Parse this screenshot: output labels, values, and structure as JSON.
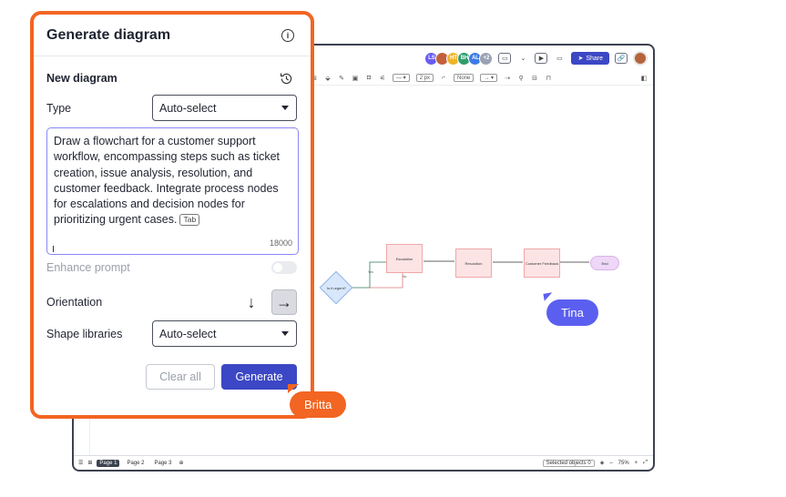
{
  "panel": {
    "title": "Generate diagram",
    "info_icon": "info-icon",
    "subtitle": "New diagram",
    "history_icon": "history-icon",
    "type_label": "Type",
    "type_value": "Auto-select",
    "prompt_text": "Draw a flowchart for a customer support workflow, encompassing steps such as ticket creation, issue analysis, resolution, and customer feedback. Integrate process nodes for escalations and decision nodes for prioritizing urgent cases.",
    "prompt_tab_chip": "Tab",
    "char_count": "18000",
    "enhance_label": "Enhance prompt",
    "enhance_enabled": false,
    "orientation_label": "Orientation",
    "orientation_options": [
      "↓",
      "→"
    ],
    "orientation_selected": "→",
    "shape_libraries_label": "Shape libraries",
    "shape_libraries_value": "Auto-select",
    "clear_label": "Clear all",
    "generate_label": "Generate"
  },
  "window": {
    "avatars": [
      {
        "initials": "LS",
        "color": "#6a5cf0"
      },
      {
        "initials": "",
        "color": "#c2603c"
      },
      {
        "initials": "HT",
        "color": "#f0b429"
      },
      {
        "initials": "BH",
        "color": "#2f9e6e"
      },
      {
        "initials": "AL",
        "color": "#3d7be6"
      },
      {
        "initials": "+2",
        "color": "#9aa3b5"
      }
    ],
    "share_label": "Share",
    "toolbar": {
      "stroke_width": "2 px",
      "line_start": "None"
    },
    "pages": [
      "Page 1",
      "Page 2",
      "Page 3"
    ],
    "selected_objects_label": "Selected objects",
    "selected_objects_count": "0",
    "zoom": "75%"
  },
  "flowchart": {
    "decision": "Is it urgent?",
    "edge_yes": "Yes",
    "edge_no": "No",
    "escalation": "Escalation",
    "resolution": "Resolution",
    "feedback": "Customer Feedback",
    "end": "End"
  },
  "cursors": {
    "tina": "Tina",
    "britta": "Britta"
  },
  "colors": {
    "accent_orange": "#f26522",
    "primary_blue": "#3b47c4",
    "prompt_border": "#8a86f5",
    "tina_purple": "#5b5ff0"
  }
}
